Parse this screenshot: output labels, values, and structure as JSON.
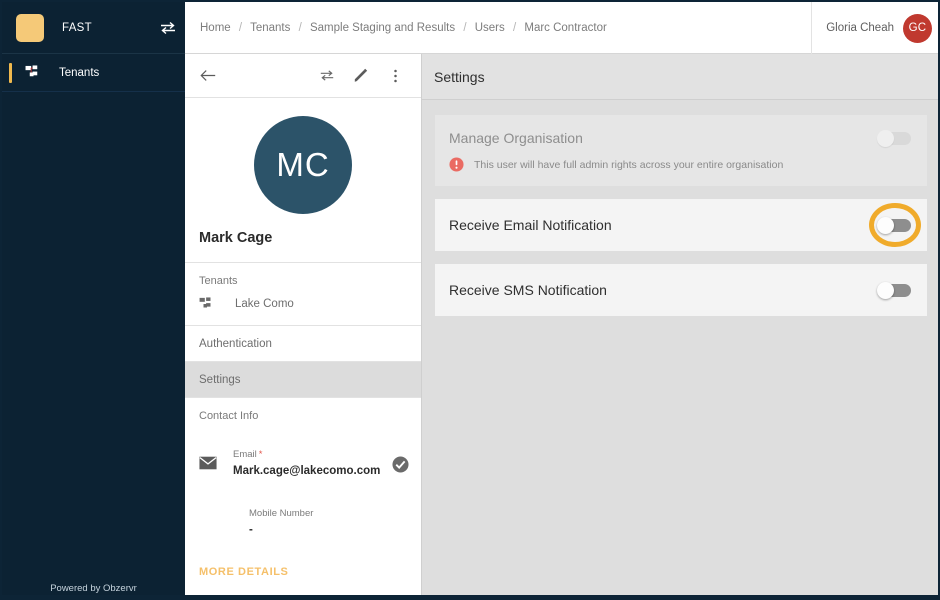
{
  "sidebar": {
    "brand_name": "FAST",
    "swap_icon": "swap-arrows-icon",
    "logo_color": "#f5c978",
    "nav_items": [
      {
        "label": "Tenants",
        "icon": "sitemap-icon",
        "active": true
      }
    ],
    "footer": "Powered by Obzervr",
    "background": "#0c2233"
  },
  "topbar": {
    "breadcrumb": [
      "Home",
      "Tenants",
      "Sample Staging and Results",
      "Users",
      "Marc Contractor"
    ],
    "separator": "/",
    "user_name": "Gloria Cheah",
    "user_initials": "GC",
    "avatar_color": "#c0392f"
  },
  "detail": {
    "toolbar": {
      "back_icon": "arrow-left-icon",
      "transfer_icon": "swap-arrows-icon",
      "edit_icon": "pencil-icon",
      "more_icon": "more-vertical-icon"
    },
    "avatar_initials": "MC",
    "avatar_color": "#2c5369",
    "person_name": "Mark Cage",
    "tenants_section": {
      "title": "Tenants",
      "items": [
        {
          "label": "Lake Como",
          "icon": "sitemap-icon"
        }
      ]
    },
    "nav_rows": [
      {
        "label": "Authentication",
        "selected": false
      },
      {
        "label": "Settings",
        "selected": true
      }
    ],
    "contact_info": {
      "title": "Contact Info",
      "fields": [
        {
          "label": "Email",
          "required": true,
          "value": "Mark.cage@lakecomo.com",
          "icon": "envelope-icon",
          "verified_icon": "check-circle-icon"
        },
        {
          "label": "Mobile Number",
          "required": false,
          "value": "-",
          "icon": "",
          "verified_icon": ""
        }
      ],
      "more_details_label": "MORE DETAILS",
      "more_details_color": "#f5c06a"
    }
  },
  "settings_panel": {
    "title": "Settings",
    "rows": [
      {
        "label": "Manage Organisation",
        "toggle_state": "off",
        "toggle_disabled": true,
        "highlighted": false,
        "warning_icon": "alert-circle-icon",
        "warning_text": "This user will have full admin rights across your entire organisation"
      },
      {
        "label": "Receive Email Notification",
        "toggle_state": "off",
        "toggle_disabled": false,
        "highlighted": true,
        "warning_icon": "",
        "warning_text": ""
      },
      {
        "label": "Receive SMS Notification",
        "toggle_state": "off",
        "toggle_disabled": false,
        "highlighted": false,
        "warning_icon": "",
        "warning_text": ""
      }
    ],
    "highlight_color": "#f0ab2b"
  }
}
